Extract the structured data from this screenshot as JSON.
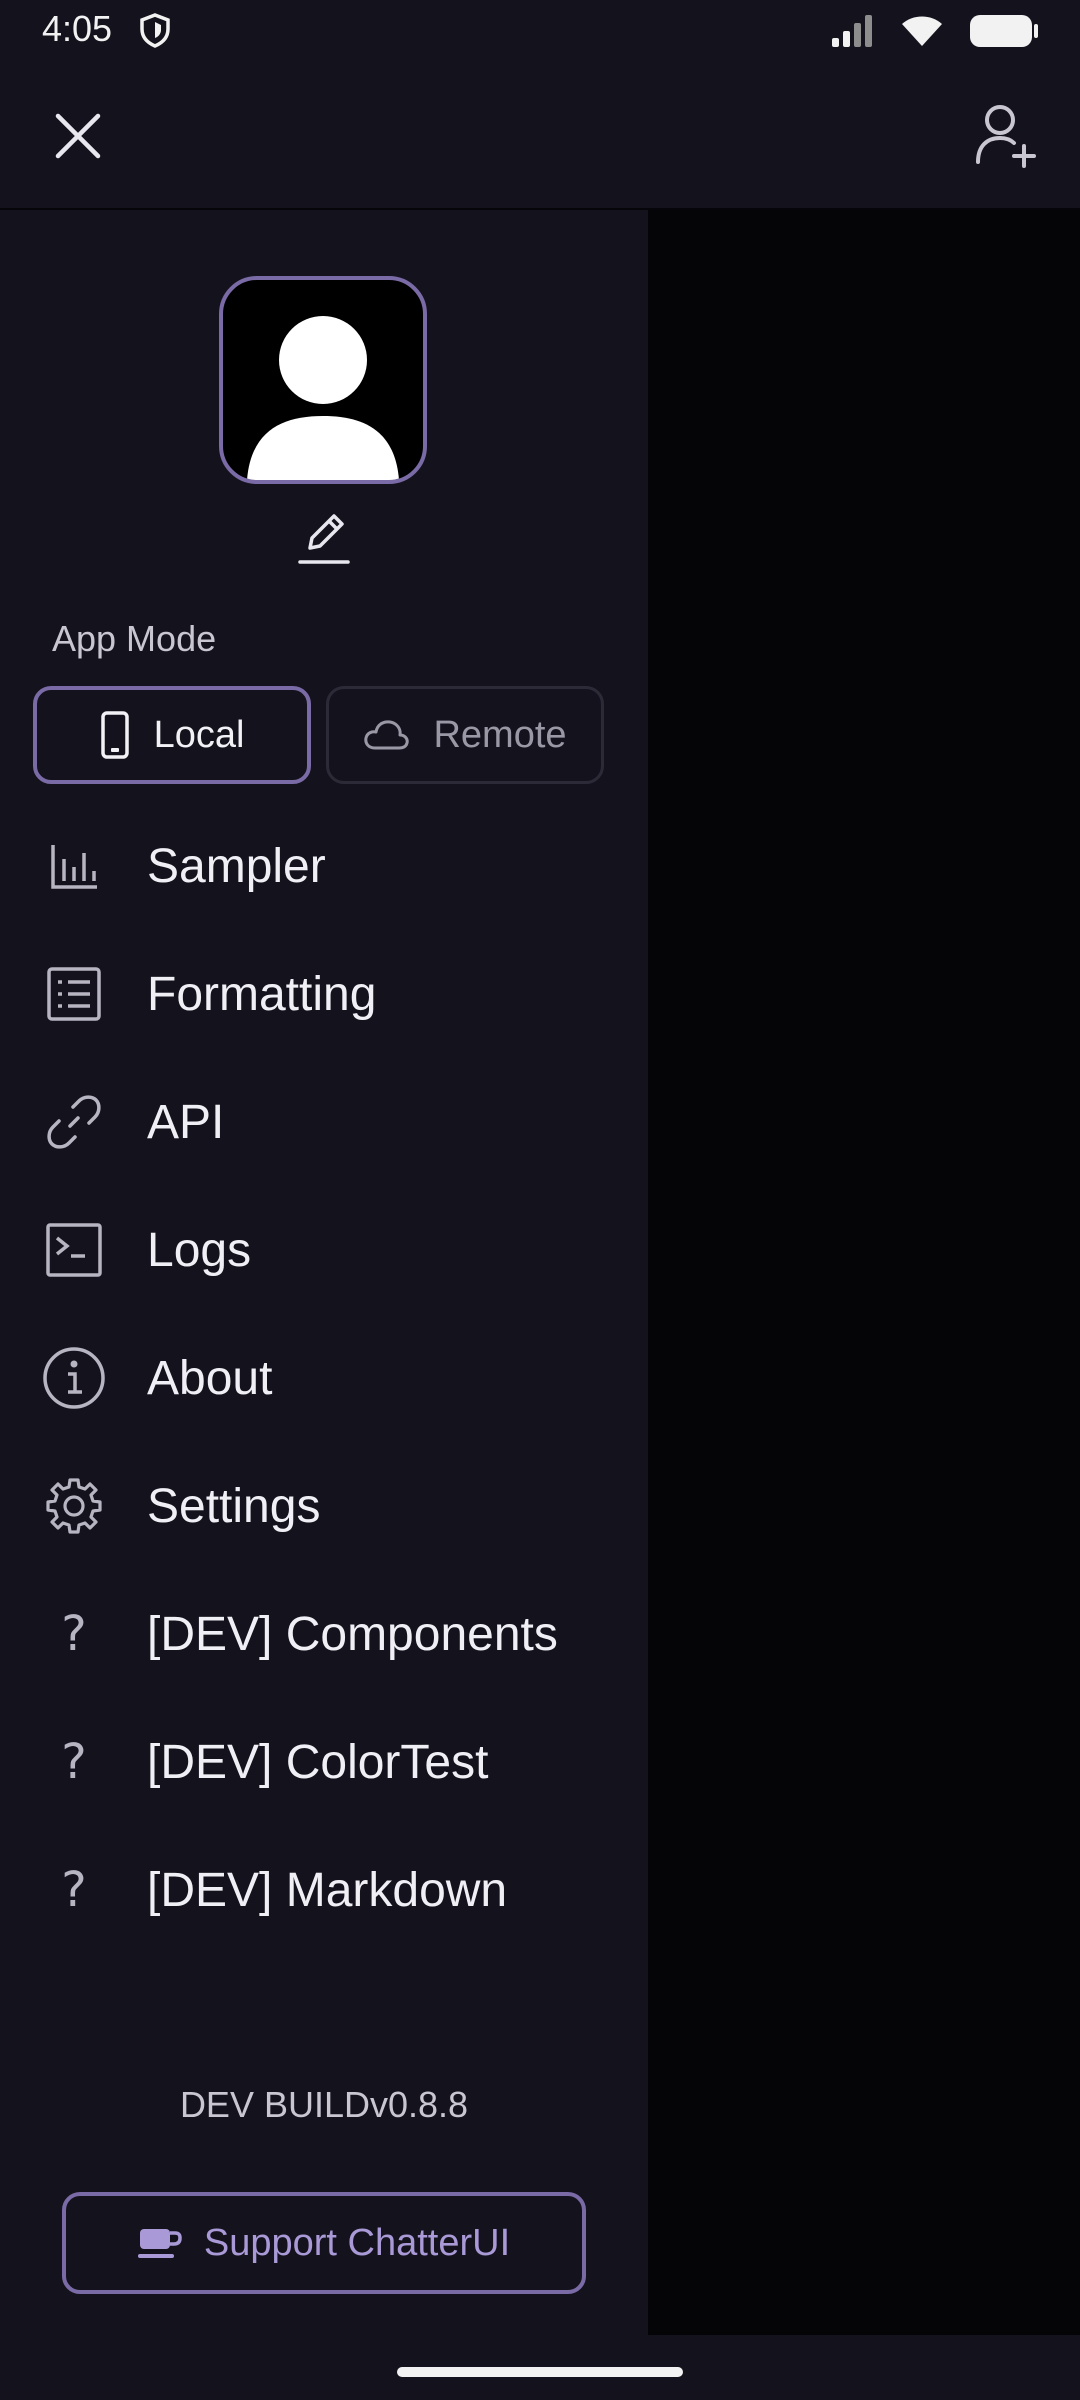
{
  "status_bar": {
    "time": "4:05",
    "icons": [
      "shield-icon",
      "signal-icon",
      "wifi-icon",
      "battery-icon"
    ]
  },
  "header": {
    "left_icon": "close-icon",
    "right_icon": "add-user-icon"
  },
  "profile": {
    "avatar_icon": "person-icon",
    "edit_icon": "pencil-icon"
  },
  "app_mode": {
    "label": "App Mode",
    "options": [
      {
        "label": "Local",
        "icon": "phone-icon",
        "selected": true
      },
      {
        "label": "Remote",
        "icon": "cloud-icon",
        "selected": false
      }
    ]
  },
  "menu": [
    {
      "label": "Sampler",
      "icon": "bar-chart-icon"
    },
    {
      "label": "Formatting",
      "icon": "list-icon"
    },
    {
      "label": "API",
      "icon": "link-icon"
    },
    {
      "label": "Logs",
      "icon": "terminal-icon"
    },
    {
      "label": "About",
      "icon": "info-icon"
    },
    {
      "label": "Settings",
      "icon": "gear-icon"
    },
    {
      "label": "[DEV] Components",
      "icon": "question-icon"
    },
    {
      "label": "[DEV] ColorTest",
      "icon": "question-icon"
    },
    {
      "label": "[DEV] Markdown",
      "icon": "question-icon"
    }
  ],
  "footer": {
    "version": "DEV BUILDv0.8.8",
    "support_label": "Support ChatterUI",
    "support_icon": "coffee-icon"
  },
  "colors": {
    "background": "#14131d",
    "accent": "#7a6aa6",
    "accent_text": "#a999d6",
    "overlay": "#050507"
  }
}
